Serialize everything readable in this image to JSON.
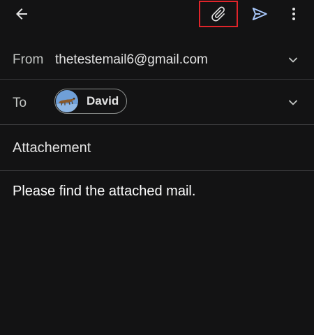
{
  "compose": {
    "from_label": "From",
    "from_email": "thetestemail6@gmail.com",
    "to_label": "To",
    "recipient_name": "David",
    "subject": "Attachement",
    "body": "Please find the attached mail."
  },
  "toolbar": {
    "back_icon": "arrow-left-icon",
    "attach_icon": "paperclip-icon",
    "send_icon": "send-icon",
    "more_icon": "more-vert-icon"
  },
  "colors": {
    "background": "#131314",
    "text": "#e3e3e3",
    "send_accent": "#a8c7fa",
    "highlight": "#e0242a",
    "divider": "#3a3a3c"
  }
}
